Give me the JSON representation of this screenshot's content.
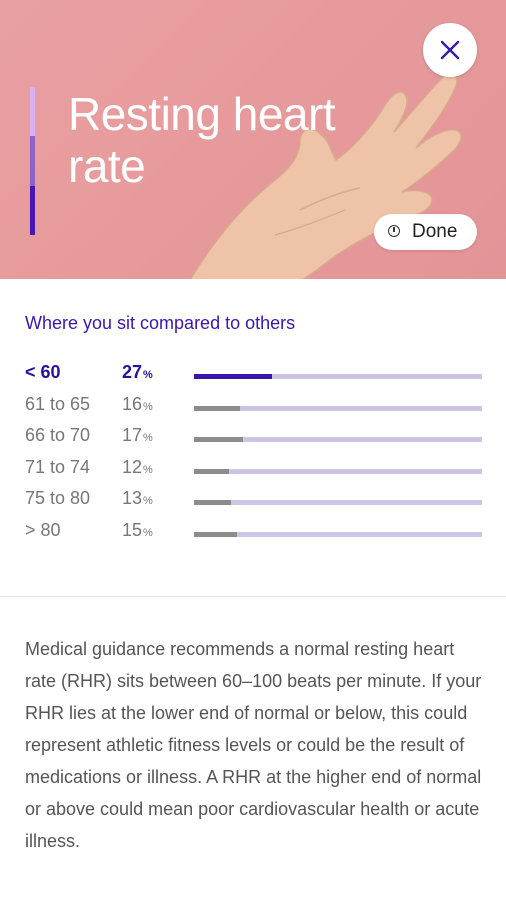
{
  "header": {
    "title": "Resting heart rate",
    "close_icon": "close-icon",
    "done_label": "Done",
    "done_icon": "clock-icon",
    "background_color": "#e79b9d",
    "accent_colors": [
      "#d9b0f2",
      "#8f62c8",
      "#4a15b4"
    ]
  },
  "comparison": {
    "title": "Where you sit compared to others",
    "percent_sign": "%",
    "highlight_color": "#3815ab",
    "track_color": "#cdc5e6",
    "rows": [
      {
        "range": "< 60",
        "percent": "27",
        "fraction": 0.27,
        "highlighted": true
      },
      {
        "range": "61 to 65",
        "percent": "16",
        "fraction": 0.16,
        "highlighted": false
      },
      {
        "range": "66 to 70",
        "percent": "17",
        "fraction": 0.17,
        "highlighted": false
      },
      {
        "range": "71 to 74",
        "percent": "12",
        "fraction": 0.12,
        "highlighted": false
      },
      {
        "range": "75 to 80",
        "percent": "13",
        "fraction": 0.13,
        "highlighted": false
      },
      {
        "range": "> 80",
        "percent": "15",
        "fraction": 0.15,
        "highlighted": false
      }
    ]
  },
  "description": "Medical guidance recommends a normal resting heart rate (RHR) sits between 60–100 beats per minute. If your RHR lies at the lower end of normal or below, this could represent athletic fitness levels or could be the result of medications or illness. A RHR at the higher end of normal or above could mean poor cardiovascular health or acute illness."
}
